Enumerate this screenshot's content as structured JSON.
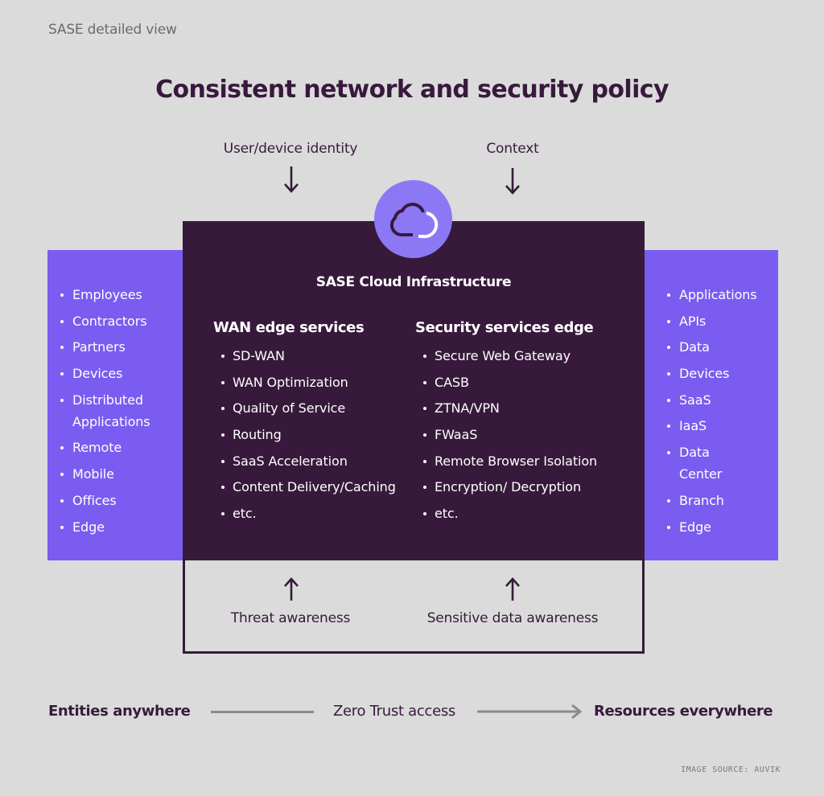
{
  "header": {
    "subtitle": "SASE detailed view",
    "title": "Consistent network and security policy"
  },
  "inputs": {
    "top_left": "User/device identity",
    "top_right": "Context",
    "bottom_left": "Threat awareness",
    "bottom_right": "Sensitive data awareness"
  },
  "entities": {
    "items": [
      "Employees",
      "Contractors",
      "Partners",
      "Devices",
      "Distributed Applications",
      "Remote",
      "Mobile",
      "Offices",
      "Edge"
    ]
  },
  "resources": {
    "items": [
      "Applications",
      "APIs",
      "Data",
      "Devices",
      "SaaS",
      "IaaS",
      "Data Center",
      "Branch",
      "Edge"
    ]
  },
  "core": {
    "title": "SASE Cloud Infrastructure",
    "icon": "cloud-icon",
    "wan": {
      "heading": "WAN edge services",
      "items": [
        "SD-WAN",
        "WAN Optimization",
        "Quality of Service",
        "Routing",
        "SaaS Acceleration",
        "Content Delivery/Caching",
        "etc."
      ]
    },
    "sse": {
      "heading": "Security services edge",
      "items": [
        "Secure Web Gateway",
        "CASB",
        "ZTNA/VPN",
        "FWaaS",
        "Remote Browser Isolation",
        "Encryption/ Decryption",
        "etc."
      ]
    }
  },
  "footer": {
    "left": "Entities anywhere",
    "middle": "Zero Trust access",
    "right": "Resources everywhere",
    "source": "IMAGE SOURCE: AUVIK"
  },
  "colors": {
    "background": "#dbdbdb",
    "dark_plum": "#371a3b",
    "purple": "#7a5cf0",
    "light_purple": "#8c78f5",
    "arrow_gray": "#8a8a8a"
  }
}
